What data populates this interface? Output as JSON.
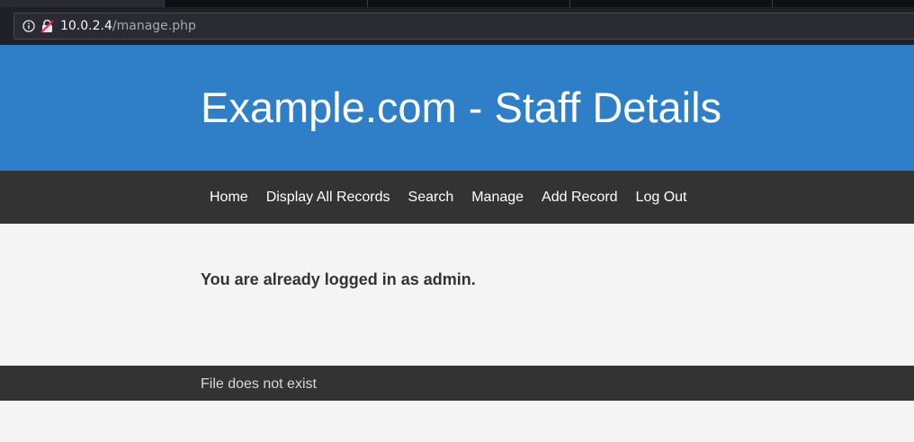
{
  "browser": {
    "url_host": "10.0.2.4",
    "url_path": "/manage.php"
  },
  "header": {
    "title": "Example.com - Staff Details"
  },
  "nav": {
    "items": [
      {
        "label": "Home"
      },
      {
        "label": "Display All Records"
      },
      {
        "label": "Search"
      },
      {
        "label": "Manage"
      },
      {
        "label": "Add Record"
      },
      {
        "label": "Log Out"
      }
    ]
  },
  "main": {
    "message": "You are already logged in as admin."
  },
  "footer": {
    "text": "File does not exist"
  },
  "colors": {
    "header_bg": "#2e7fc8",
    "nav_bg": "#333333",
    "page_bg": "#f4f4f4"
  },
  "icons": {
    "info": "info-icon",
    "insecure_lock": "insecure-lock-icon"
  }
}
